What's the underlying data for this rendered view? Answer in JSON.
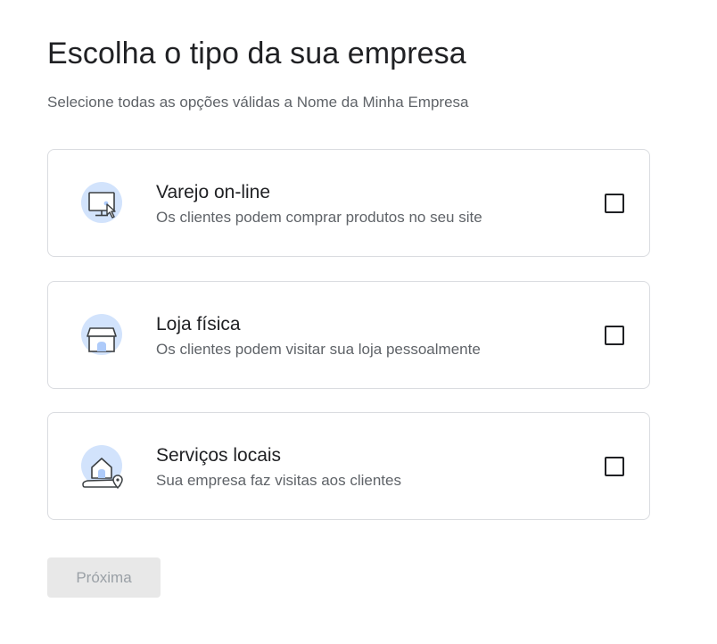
{
  "page": {
    "title": "Escolha o tipo da sua empresa",
    "subtitle": "Selecione todas as opções válidas a Nome da Minha Empresa"
  },
  "options": [
    {
      "title": "Varejo on-line",
      "description": "Os clientes podem comprar produtos no seu site",
      "icon": "computer-cursor-icon",
      "checked": false
    },
    {
      "title": "Loja física",
      "description": "Os clientes podem visitar sua loja pessoalmente",
      "icon": "storefront-icon",
      "checked": false
    },
    {
      "title": "Serviços locais",
      "description": "Sua empresa faz visitas aos clientes",
      "icon": "home-map-pin-icon",
      "checked": false
    }
  ],
  "actions": {
    "next_label": "Próxima",
    "next_enabled": false
  },
  "colors": {
    "icon_circle": "#d2e3fc",
    "icon_stroke": "#3c4043",
    "icon_fill": "#aecbfa",
    "border": "#dadce0",
    "secondary_text": "#5f6368",
    "disabled_button_bg": "#e8e8e8",
    "disabled_button_text": "#9aa0a6"
  }
}
